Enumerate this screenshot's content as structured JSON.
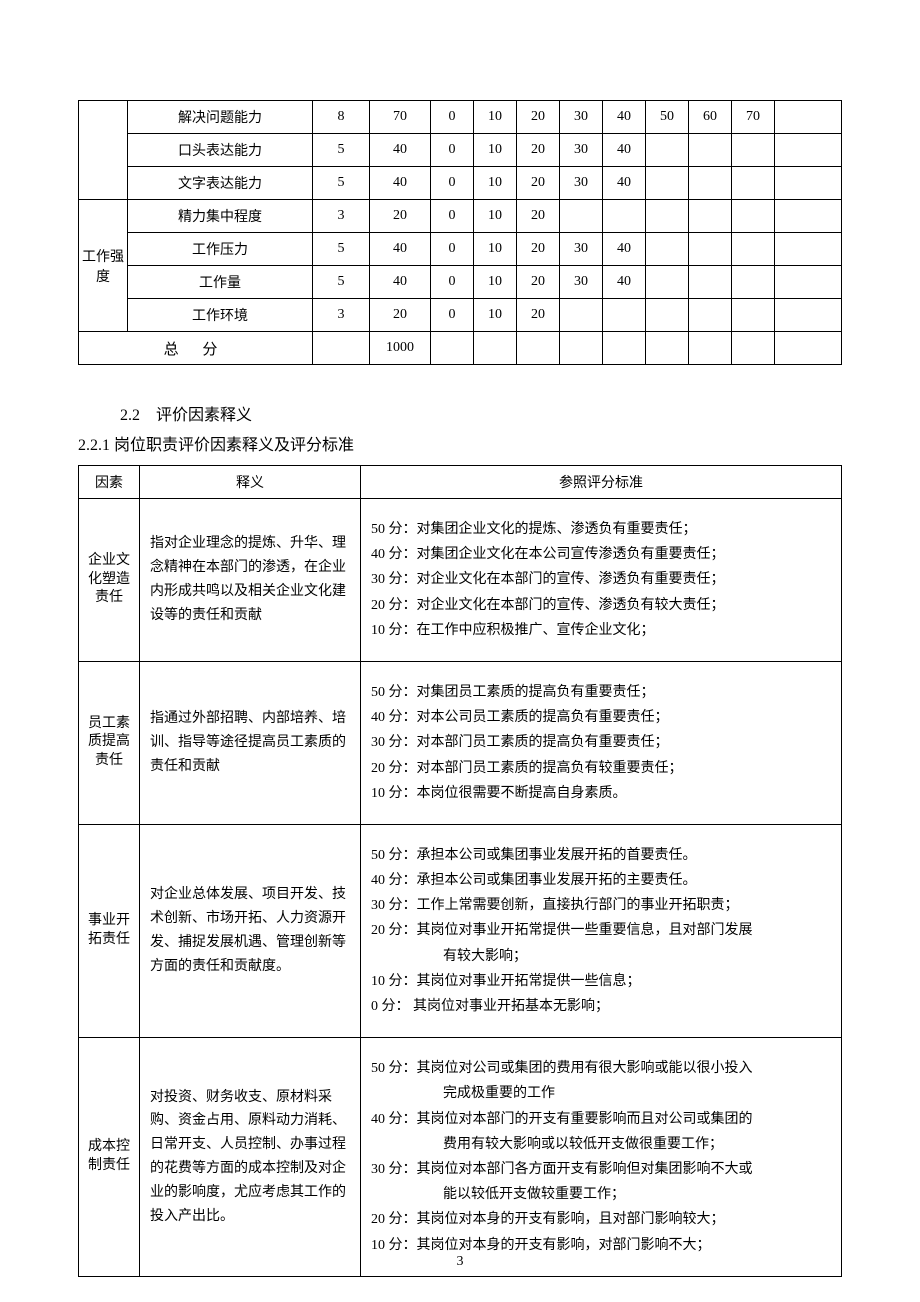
{
  "table1": {
    "rowgroup_label": "工作强度",
    "rows": [
      {
        "cat": "",
        "name": "解决问题能力",
        "w": "8",
        "s": "70",
        "v": [
          "0",
          "10",
          "20",
          "30",
          "40",
          "50",
          "60",
          "70",
          ""
        ]
      },
      {
        "cat": "",
        "name": "口头表达能力",
        "w": "5",
        "s": "40",
        "v": [
          "0",
          "10",
          "20",
          "30",
          "40",
          "",
          "",
          "",
          ""
        ]
      },
      {
        "cat": "",
        "name": "文字表达能力",
        "w": "5",
        "s": "40",
        "v": [
          "0",
          "10",
          "20",
          "30",
          "40",
          "",
          "",
          "",
          ""
        ]
      },
      {
        "cat": "grp",
        "name": "精力集中程度",
        "w": "3",
        "s": "20",
        "v": [
          "0",
          "10",
          "20",
          "",
          "",
          "",
          "",
          "",
          ""
        ]
      },
      {
        "cat": "grp",
        "name": "工作压力",
        "w": "5",
        "s": "40",
        "v": [
          "0",
          "10",
          "20",
          "30",
          "40",
          "",
          "",
          "",
          ""
        ]
      },
      {
        "cat": "grp",
        "name": "工作量",
        "w": "5",
        "s": "40",
        "v": [
          "0",
          "10",
          "20",
          "30",
          "40",
          "",
          "",
          "",
          ""
        ]
      },
      {
        "cat": "grp",
        "name": "工作环境",
        "w": "3",
        "s": "20",
        "v": [
          "0",
          "10",
          "20",
          "",
          "",
          "",
          "",
          "",
          ""
        ]
      }
    ],
    "total_label": "总  分",
    "total_value": "1000"
  },
  "sec_heading": "2.2　评价因素释义",
  "sub_heading": "2.2.1  岗位职责评价因素释义及评分标准",
  "table2": {
    "headers": [
      "因素",
      "释义",
      "参照评分标准"
    ],
    "rows": [
      {
        "factor": "企业文化塑造责任",
        "desc": "指对企业理念的提炼、升华、理念精神在本部门的渗透，在企业内形成共鸣以及相关企业文化建设等的责任和贡献",
        "std": [
          "50 分：对集团企业文化的提炼、渗透负有重要责任；",
          "40 分：对集团企业文化在本公司宣传渗透负有重要责任；",
          "30 分：对企业文化在本部门的宣传、渗透负有重要责任；",
          "20 分：对企业文化在本部门的宣传、渗透负有较大责任；",
          "10 分：在工作中应积极推广、宣传企业文化；"
        ]
      },
      {
        "factor": "员工素质提高责任",
        "desc": "指通过外部招聘、内部培养、培训、指导等途径提高员工素质的责任和贡献",
        "std": [
          "50 分：对集团员工素质的提高负有重要责任；",
          "40 分：对本公司员工素质的提高负有重要责任；",
          "30 分：对本部门员工素质的提高负有重要责任；",
          "20 分：对本部门员工素质的提高负有较重要责任；",
          "10 分：本岗位很需要不断提高自身素质。"
        ]
      },
      {
        "factor": "事业开拓责任",
        "desc": "对企业总体发展、项目开发、技术创新、市场开拓、人力资源开发、捕捉发展机遇、管理创新等方面的责任和贡献度。",
        "std": [
          "50 分：承担本公司或集团事业发展开拓的首要责任。",
          "40 分：承担本公司或集团事业发展开拓的主要责任。",
          "30 分：工作上常需要创新，直接执行部门的事业开拓职责；",
          "20 分：其岗位对事业开拓常提供一些重要信息，且对部门发展",
          "　有较大影响；",
          "10 分：其岗位对事业开拓常提供一些信息；",
          "0 分：  其岗位对事业开拓基本无影响；"
        ]
      },
      {
        "factor": "成本控制责任",
        "desc": "对投资、财务收支、原材料采购、资金占用、原料动力消耗、日常开支、人员控制、办事过程的花费等方面的成本控制及对企业的影响度，尤应考虑其工作的投入产出比。",
        "std": [
          "50 分：其岗位对公司或集团的费用有很大影响或能以很小投入",
          "　完成极重要的工作",
          "40 分：其岗位对本部门的开支有重要影响而且对公司或集团的",
          "　费用有较大影响或以较低开支做很重要工作；",
          "30 分：其岗位对本部门各方面开支有影响但对集团影响不大或",
          "　能以较低开支做较重要工作；",
          "20 分：其岗位对本身的开支有影响，且对部门影响较大；",
          "10 分：其岗位对本身的开支有影响，对部门影响不大；"
        ]
      }
    ]
  },
  "page_no": "3"
}
